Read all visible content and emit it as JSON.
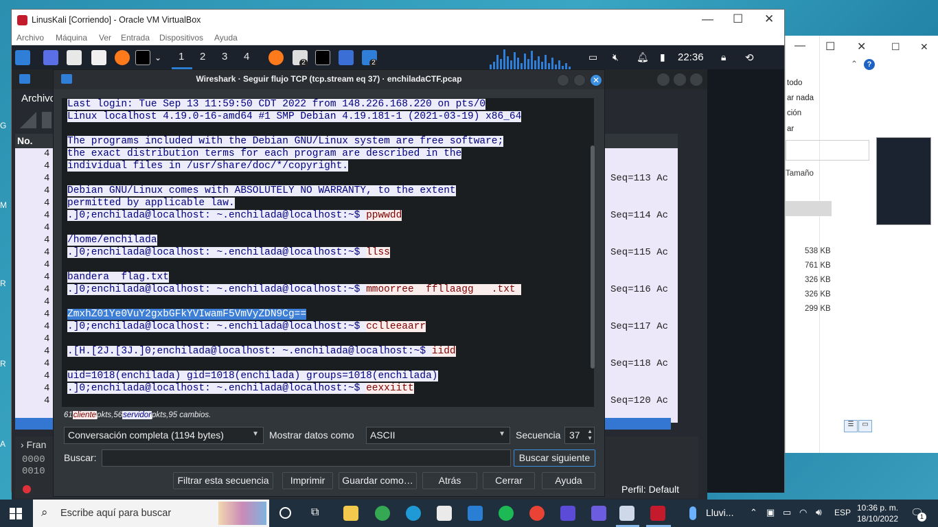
{
  "desktop": {
    "frags": [
      "G",
      "M",
      "R",
      "R",
      "A"
    ]
  },
  "explorer": {
    "ribbon": [
      "todo",
      "ar nada",
      "ción",
      "ar"
    ],
    "column_tamano": "Tamaño",
    "sizes": [
      "538 KB",
      "761 KB",
      "326 KB",
      "326 KB",
      "299 KB"
    ]
  },
  "vbox": {
    "title": "LinusKali [Corriendo] - Oracle VM VirtualBox",
    "menu": [
      "Archivo",
      "Máquina",
      "Ver",
      "Entrada",
      "Dispositivos",
      "Ayuda"
    ]
  },
  "kali_panel": {
    "workspaces": [
      "1",
      "2",
      "3",
      "4"
    ],
    "badge_a": "2",
    "badge_b": "2",
    "time": "22:36"
  },
  "wireshark_main": {
    "menu_archivo": "Archivo",
    "col_no": "No.",
    "row_no_prefix": "4",
    "seq_labels": [
      "Seq=113 Ac",
      "Seq=114 Ac",
      "Seq=115 Ac",
      "Seq=116 Ac",
      "Seq=117 Ac",
      "Seq=118 Ac",
      "Seq=120 Ac"
    ],
    "frame_label": "Fran",
    "hex_rows": [
      "0000",
      "0010"
    ],
    "perfil": "Perfil: Default"
  },
  "dialog": {
    "title": "Wireshark · Seguir flujo TCP (tcp.stream eq 37) · enchiladaCTF.pcap",
    "stream_lines": [
      {
        "t": "Last login: Tue Sep 13 11:59:50 CDT 2022 from 148.226.168.220 on pts/0"
      },
      {
        "t": "Linux localhost 4.19.0-16-amd64 #1 SMP Debian 4.19.181-1 (2021-03-19) x86_64"
      },
      {
        "t": ""
      },
      {
        "t": "The programs included with the Debian GNU/Linux system are free software;"
      },
      {
        "t": "the exact distribution terms for each program are described in the"
      },
      {
        "t": "individual files in /usr/share/doc/*/copyright."
      },
      {
        "t": ""
      },
      {
        "t": "Debian GNU/Linux comes with ABSOLUTELY NO WARRANTY, to the extent"
      },
      {
        "t": "permitted by applicable law."
      },
      {
        "t": ".]0;enchilada@localhost: ~.enchilada@localhost:~$ ",
        "c": "ppwwdd"
      },
      {
        "t": ""
      },
      {
        "t": "/home/enchilada"
      },
      {
        "t": ".]0;enchilada@localhost: ~.enchilada@localhost:~$ ",
        "c": "llss"
      },
      {
        "t": ""
      },
      {
        "t": "bandera  flag.txt"
      },
      {
        "t": ".]0;enchilada@localhost: ~.enchilada@localhost:~$ ",
        "c": "mmoorree  ffllaagg   .txt "
      },
      {
        "t": ""
      },
      {
        "t": "ZmxhZ01Ye0VuY2gxbGFkYVIwamF5VmVyZDN9Cg==",
        "hl": true
      },
      {
        "t": ".]0;enchilada@localhost: ~.enchilada@localhost:~$ ",
        "c": "cclleeaarr"
      },
      {
        "t": ""
      },
      {
        "t": ".[H.[2J.[3J.]0;enchilada@localhost: ~.enchilada@localhost:~$ ",
        "c": "iidd"
      },
      {
        "t": ""
      },
      {
        "t": "uid=1018(enchilada) gid=1018(enchilada) groups=1018(enchilada)"
      },
      {
        "t": ".]0;enchilada@localhost: ~.enchilada@localhost:~$ ",
        "c": "eexxiitt"
      }
    ],
    "summary": {
      "count_client": "61",
      "client": "cliente",
      "mid": "pkts,56",
      "server": "servidor",
      "tail": "pkts,95 cambios."
    },
    "conversation": "Conversación completa (1194 bytes)",
    "show_data_label": "Mostrar datos como",
    "show_data_value": "ASCII",
    "sequence_label": "Secuencia",
    "sequence_value": "37",
    "search_label": "Buscar:",
    "search_value": "",
    "btn_next": "Buscar siguiente",
    "btn_filter": "Filtrar esta secuencia",
    "btn_print": "Imprimir",
    "btn_save": "Guardar como…",
    "btn_back": "Atrás",
    "btn_close": "Cerrar",
    "btn_help": "Ayuda"
  },
  "taskbar": {
    "search_placeholder": "Escribe aquí para buscar",
    "lluvi": "Lluvi...",
    "lang": "ESP",
    "time": "10:36 p. m.",
    "date": "18/10/2022",
    "notif": "1"
  }
}
